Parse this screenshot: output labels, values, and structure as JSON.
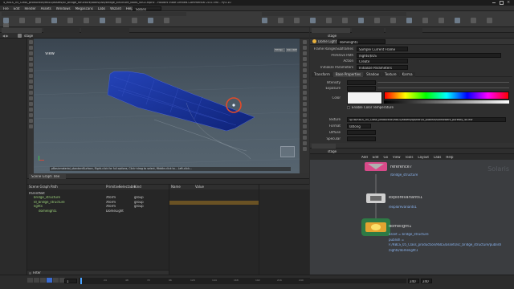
{
  "window": {
    "title": "4_RBLS_05_Class_production/RBLS/assets/sc_bridge_structure/looks/usd/bridge_structure_looks_v002.hipnc - Houdini Indie Limited-Commercial 20.0.590 - Py3.10"
  },
  "menubar": [
    "File",
    "Edit",
    "Render",
    "Assets",
    "Windows",
    "Megascans",
    "Labs",
    "Wizard",
    "Help"
  ],
  "desktop": "Solaris",
  "stage": "stage",
  "viewport": {
    "label": "View",
    "persp": "Persp",
    "cam": "No cam",
    "status": "pBasicmaterial_standardSurface, Right-click for full options, Click+drag to select, Middle-click to... Left-click..."
  },
  "scene_graph": {
    "tab": "Scene Graph Tree",
    "columns": [
      "Scene Graph Path",
      "Primitive",
      "Selectable",
      "Kind"
    ],
    "rows": [
      {
        "path": "ParentNet",
        "prim": "",
        "sel": "",
        "kind": ""
      },
      {
        "path": "bridge_structure",
        "prim": "Xform",
        "sel": "",
        "kind": "group"
      },
      {
        "path": "ld_bridge_structure",
        "prim": "Xform",
        "sel": "",
        "kind": "group"
      },
      {
        "path": "lights",
        "prim": "Xform",
        "sel": "",
        "kind": "group"
      },
      {
        "path": "domelight1",
        "prim": "DomeLight",
        "sel": "",
        "kind": ""
      }
    ],
    "right_columns": [
      "Name",
      "Value"
    ],
    "filter": "Filter"
  },
  "params": {
    "tab": "Dome Light",
    "node": "domelight1",
    "rows": [
      {
        "label": "Frame Range/Subframes",
        "value": "Sample Current Frame"
      },
      {
        "label": "Primitive Path",
        "value": "/lights/$OS"
      },
      {
        "label": "Action",
        "value": "Create"
      },
      {
        "label": "Initialize Parameters",
        "value": "Initialize Parameters"
      }
    ],
    "subtabs": [
      "Transform",
      "Base Properties",
      "Shadow",
      "Texture",
      "Karma"
    ],
    "intensity_label": "Intensity",
    "exposure_label": "Exposure",
    "color_label": "Color",
    "color_temp_label": "Enable Color Temperature",
    "texture_label": "Texture",
    "texture_value": "$JOB/RBLS_05_Class_production/RBLS/assets/lgt/hdri/4_publish/sunflowers_puresky_4k.exr",
    "format_label": "Format",
    "format_value": "latlong",
    "diffuse_label": "Diffuse",
    "specular_label": "Specular"
  },
  "network": {
    "path": "stage",
    "context": "Solaris",
    "menu": [
      "Add",
      "Edit",
      "Go",
      "View",
      "Tools",
      "Layout",
      "Labs",
      "Help"
    ],
    "nodes": [
      {
        "name": "reference7",
        "sub": "/bridge_structure"
      },
      {
        "name": "explorevariants1",
        "sub": "/explorevariants1"
      },
      {
        "name": "domelight1",
        "info": [
          "asset = bridge_structure",
          "publish =",
          "F:/RBLS_05_Class_production/RBLS/assets/sc_bridge_structure/publish",
          "/lights/domelight1"
        ]
      }
    ]
  },
  "timeline": {
    "frame": "1",
    "start": "1",
    "end": "240",
    "ticks": [
      "24",
      "48",
      "72",
      "96",
      "120",
      "144",
      "168",
      "192",
      "216",
      "240"
    ],
    "range_end": "240"
  },
  "colors": {
    "accent": "#f2a531",
    "water": "#3c4b57",
    "panel": "#323232",
    "bridge": "#1e3a9a",
    "selection": "#e8e070"
  }
}
